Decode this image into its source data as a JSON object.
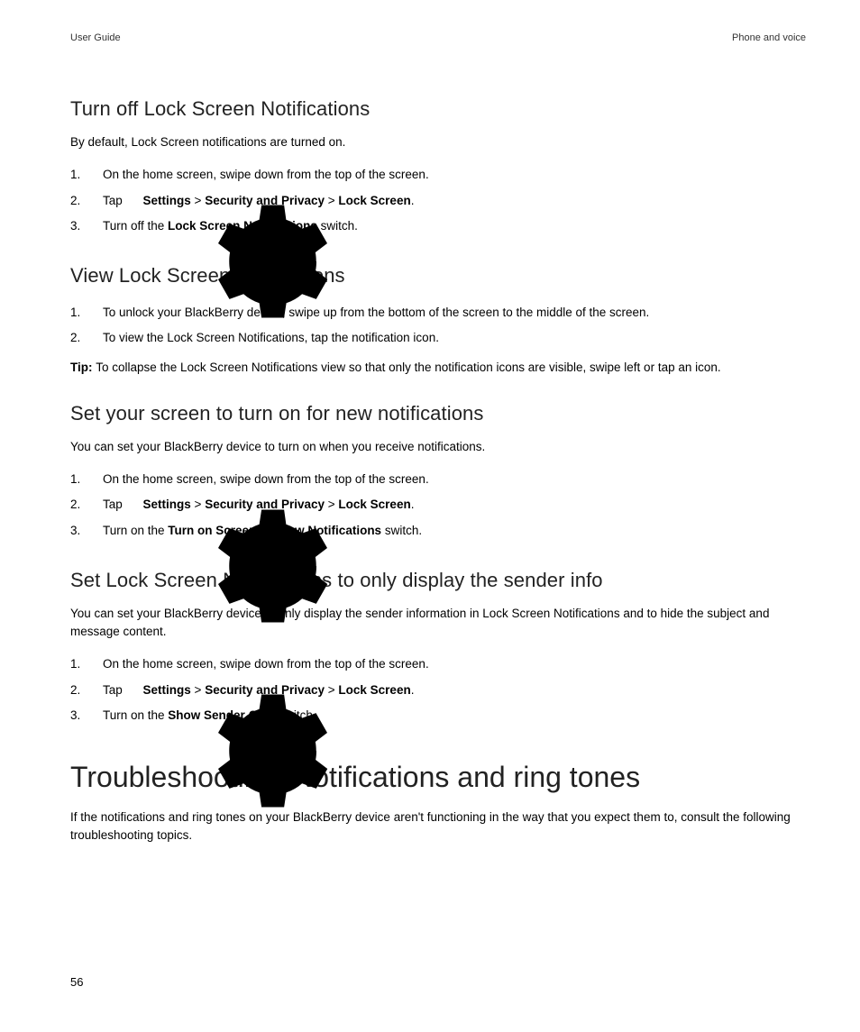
{
  "header": {
    "left": "User Guide",
    "right": "Phone and voice"
  },
  "sections": {
    "s1": {
      "title": "Turn off Lock Screen Notifications",
      "intro": "By default, Lock Screen notifications are turned on.",
      "step1": "On the home screen, swipe down from the top of the screen.",
      "step2_tap": "Tap ",
      "step2_settings": "Settings",
      "step2_sep1": " > ",
      "step2_secpriv": "Security and Privacy",
      "step2_sep2": " > ",
      "step2_lock": "Lock Screen",
      "step2_end": ".",
      "step3_a": "Turn off the ",
      "step3_b": "Lock Screen Notifications",
      "step3_c": " switch."
    },
    "s2": {
      "title": "View Lock Screen Notifications",
      "step1": "To unlock your BlackBerry device, swipe up from the bottom of the screen to the middle of the screen.",
      "step2": "To view the Lock Screen Notifications, tap the notification icon.",
      "tip_label": "Tip: ",
      "tip_text": "To collapse the Lock Screen Notifications view so that only the notification icons are visible, swipe left or tap an icon."
    },
    "s3": {
      "title": "Set your screen to turn on for new notifications",
      "intro": "You can set your BlackBerry device to turn on when you receive notifications.",
      "step1": "On the home screen, swipe down from the top of the screen.",
      "step2_tap": "Tap ",
      "step2_settings": "Settings",
      "step2_sep1": " > ",
      "step2_secpriv": "Security and Privacy",
      "step2_sep2": " > ",
      "step2_lock": "Lock Screen",
      "step2_end": ".",
      "step3_a": "Turn on the ",
      "step3_b": "Turn on Screen for New Notifications",
      "step3_c": " switch."
    },
    "s4": {
      "title": "Set Lock Screen Notifications to only display the sender info",
      "intro": "You can set your BlackBerry device to only display the sender information in Lock Screen Notifications and to hide the subject and message content.",
      "step1": "On the home screen, swipe down from the top of the screen.",
      "step2_tap": "Tap ",
      "step2_settings": "Settings",
      "step2_sep1": " > ",
      "step2_secpriv": "Security and Privacy",
      "step2_sep2": " > ",
      "step2_lock": "Lock Screen",
      "step2_end": ".",
      "step3_a": "Turn on the ",
      "step3_b": "Show Sender Only",
      "step3_c": " switch."
    },
    "s5": {
      "title": "Troubleshooting: Notifications and ring tones",
      "intro": "If the notifications and ring tones on your BlackBerry device aren't functioning in the way that you expect them to, consult the following troubleshooting topics."
    }
  },
  "page_number": "56"
}
